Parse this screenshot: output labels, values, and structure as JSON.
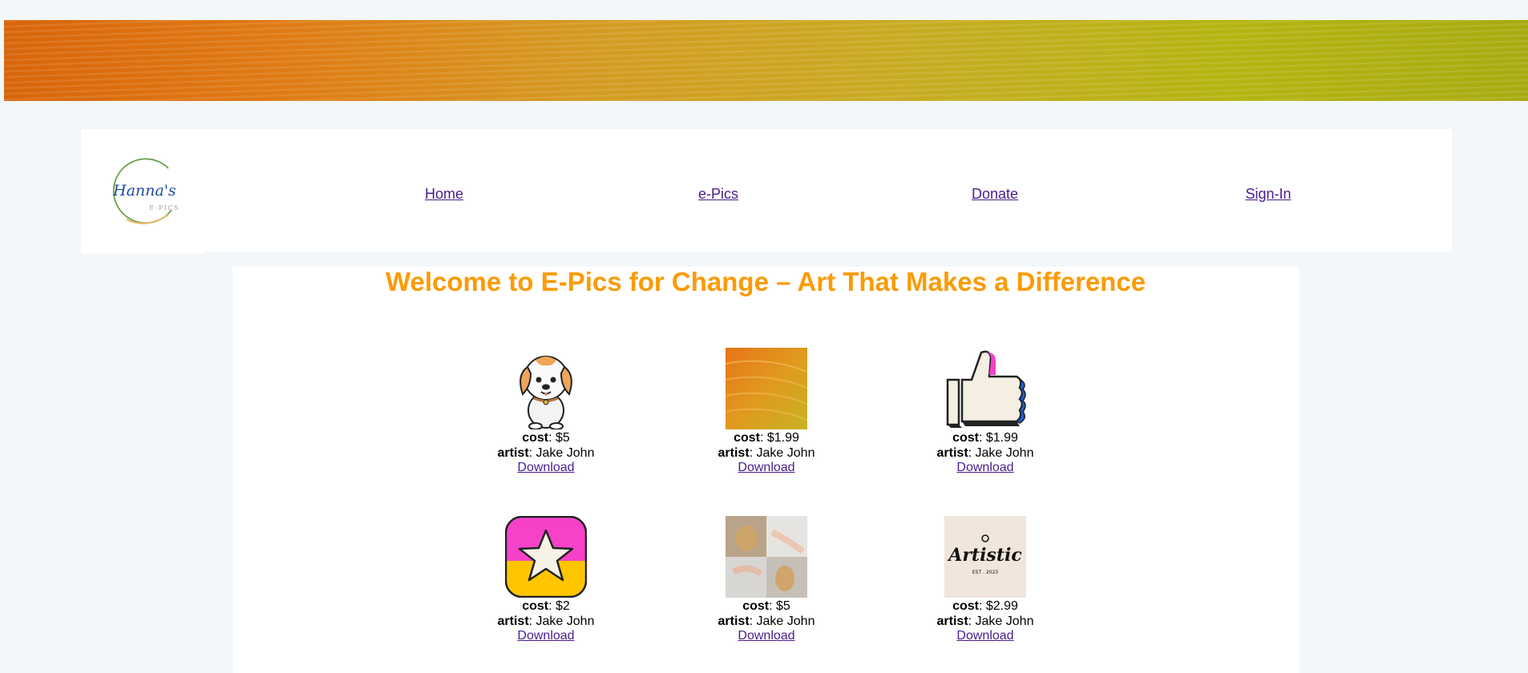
{
  "nav": {
    "logo_text": "Hanna's",
    "logo_subtext": "E-PICS",
    "links": [
      "Home",
      "e-Pics",
      "Donate",
      "Sign-In"
    ]
  },
  "main": {
    "title": "Welcome to E-Pics for Change – Art That Makes a Difference",
    "cost_label": "cost",
    "artist_label": "artist",
    "items": [
      {
        "image": "dog-icon",
        "cost": "$5",
        "artist": "Jake John",
        "download": "Download"
      },
      {
        "image": "orange-texture-image",
        "cost": "$1.99",
        "artist": "Jake John",
        "download": "Download"
      },
      {
        "image": "thumbs-up-icon",
        "cost": "$1.99",
        "artist": "Jake John",
        "download": "Download"
      },
      {
        "image": "star-icon",
        "cost": "$2",
        "artist": "Jake John",
        "download": "Download"
      },
      {
        "image": "hands-pottery-image",
        "cost": "$5",
        "artist": "Jake John",
        "download": "Download"
      },
      {
        "image": "artistic-logo-image",
        "cost": "$2.99",
        "artist": "Jake John",
        "download": "Download"
      }
    ]
  },
  "artistic_logo": {
    "text": "Artistic",
    "subtext": "EST . 2023"
  },
  "colors": {
    "title": "#fb9b05",
    "link": "#4b1c8c",
    "background": "#f3f7f9",
    "star_top": "#f542c8",
    "star_bottom": "#ffc600"
  }
}
